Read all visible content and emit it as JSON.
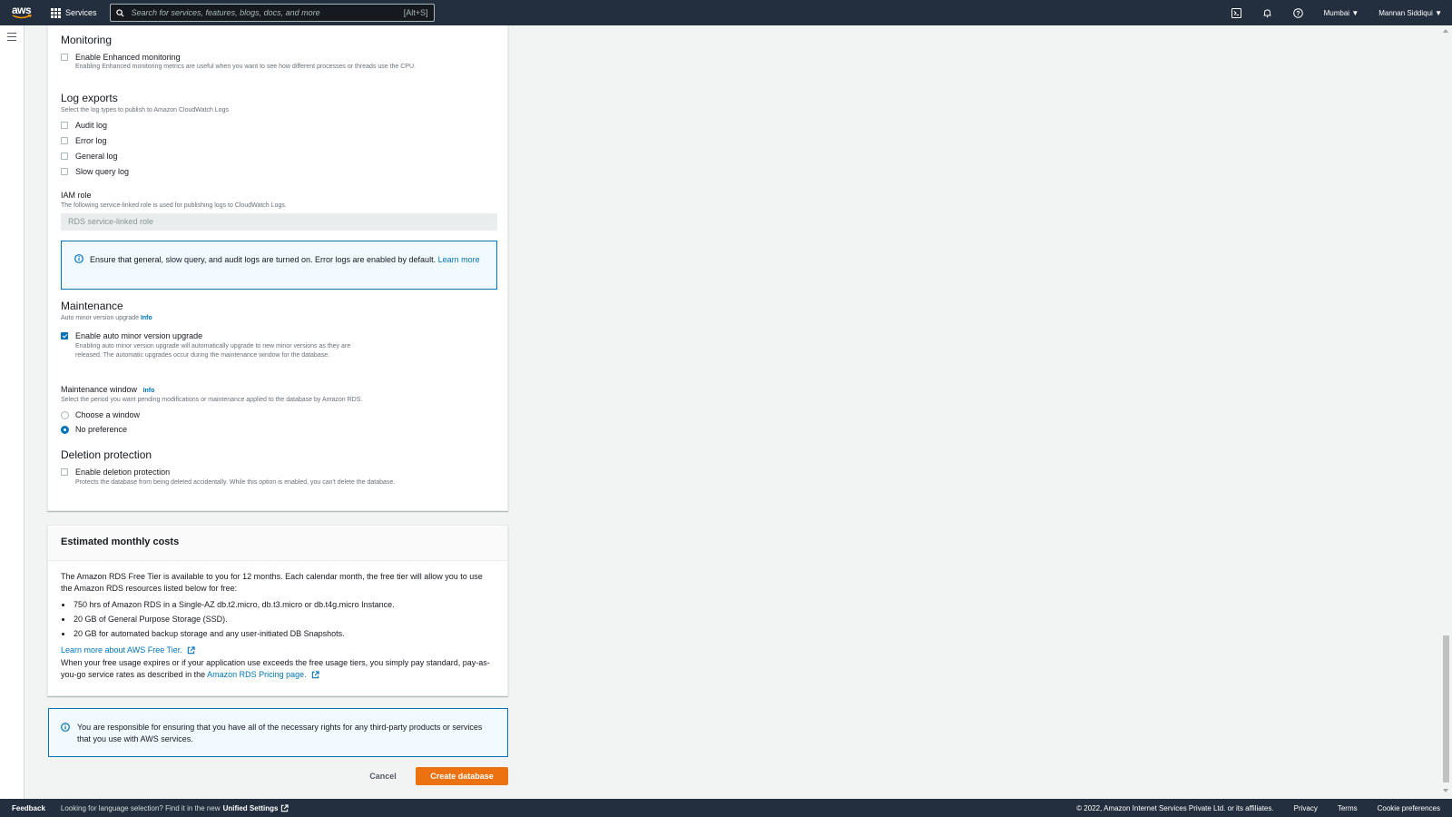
{
  "nav": {
    "logo": "aws",
    "services": "Services",
    "search_placeholder": "Search for services, features, blogs, docs, and more",
    "search_shortcut": "[Alt+S]",
    "region": "Mumbai",
    "user": "Mannan Siddiqui"
  },
  "monitoring": {
    "title": "Monitoring",
    "enhanced_label": "Enable Enhanced monitoring",
    "enhanced_desc": "Enabling Enhanced monitoring metrics are useful when you want to see how different processes or threads use the CPU.",
    "enhanced_checked": false
  },
  "log_exports": {
    "title": "Log exports",
    "desc": "Select the log types to publish to Amazon CloudWatch Logs",
    "items": [
      {
        "label": "Audit log",
        "checked": false
      },
      {
        "label": "Error log",
        "checked": false
      },
      {
        "label": "General log",
        "checked": false
      },
      {
        "label": "Slow query log",
        "checked": false
      }
    ]
  },
  "iam": {
    "label": "IAM role",
    "desc": "The following service-linked role is used for publishing logs to CloudWatch Logs.",
    "value": "RDS service-linked role"
  },
  "info_alert": {
    "text": "Ensure that general, slow query, and audit logs are turned on. Error logs are enabled by default.",
    "link": "Learn more"
  },
  "maintenance": {
    "title": "Maintenance",
    "sub": "Auto minor version upgrade",
    "info": "Info",
    "auto_label": "Enable auto minor version upgrade",
    "auto_desc": "Enabling auto minor version upgrade will automatically upgrade to new minor versions as they are released. The automatic upgrades occur during the maintenance window for the database.",
    "auto_checked": true,
    "window_label": "Maintenance window",
    "window_info": "Info",
    "window_desc": "Select the period you want pending modifications or maintenance applied to the database by Amazon RDS.",
    "options": [
      {
        "label": "Choose a window",
        "selected": false
      },
      {
        "label": "No preference",
        "selected": true
      }
    ]
  },
  "deletion": {
    "title": "Deletion protection",
    "label": "Enable deletion protection",
    "desc": "Protects the database from being deleted accidentally. While this option is enabled, you can't delete the database.",
    "checked": false
  },
  "costs": {
    "title": "Estimated monthly costs",
    "intro": "The Amazon RDS Free Tier is available to you for 12 months. Each calendar month, the free tier will allow you to use the Amazon RDS resources listed below for free:",
    "bullets": [
      "750 hrs of Amazon RDS in a Single-AZ db.t2.micro, db.t3.micro or db.t4g.micro Instance.",
      "20 GB of General Purpose Storage (SSD).",
      "20 GB for automated backup storage and any user-initiated DB Snapshots."
    ],
    "free_tier_link": "Learn more about AWS Free Tier.",
    "outro": "When your free usage expires or if your application use exceeds the free usage tiers, you simply pay standard, pay-as-you-go service rates as described in the",
    "pricing_link": "Amazon RDS Pricing page."
  },
  "rights_alert": "You are responsible for ensuring that you have all of the necessary rights for any third-party products or services that you use with AWS services.",
  "actions": {
    "cancel": "Cancel",
    "create": "Create database"
  },
  "footer": {
    "feedback": "Feedback",
    "lang_text": "Looking for language selection? Find it in the new",
    "unified": "Unified Settings",
    "copyright": "© 2022, Amazon Internet Services Private Ltd. or its affiliates.",
    "privacy": "Privacy",
    "terms": "Terms",
    "cookies": "Cookie preferences"
  },
  "colors": {
    "nav_bg": "#232f3e",
    "link": "#0073bb",
    "primary_button": "#ec7211"
  }
}
